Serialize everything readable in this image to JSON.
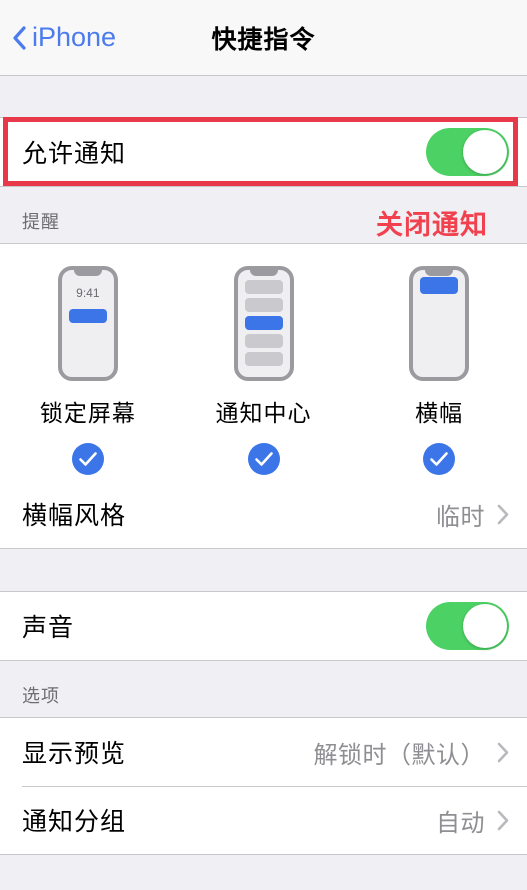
{
  "navbar": {
    "back_label": "iPhone",
    "back_icon": "chevron-left-icon",
    "title": "快捷指令"
  },
  "allow_notifications": {
    "title": "允许通知",
    "toggle_state": "on",
    "toggle_color": "#4CD264"
  },
  "alerts_section": {
    "header": "提醒",
    "previews": [
      {
        "label": "锁定屏幕",
        "time": "9:41",
        "checked": true,
        "type": "lock-screen"
      },
      {
        "label": "通知中心",
        "checked": true,
        "type": "notification-center"
      },
      {
        "label": "横幅",
        "checked": true,
        "type": "banner"
      }
    ],
    "banner_style": {
      "title": "横幅风格",
      "value": "临时",
      "chevron": "chevron-right-icon"
    }
  },
  "sounds": {
    "title": "声音",
    "toggle_state": "on",
    "toggle_color": "#4CD264"
  },
  "options_section": {
    "header": "选项",
    "rows": [
      {
        "title": "显示预览",
        "value": "解锁时（默认）",
        "chevron": "chevron-right-icon"
      },
      {
        "title": "通知分组",
        "value": "自动",
        "chevron": "chevron-right-icon"
      }
    ]
  },
  "annotations": {
    "box_color": "#E8394A",
    "text": "关闭通知",
    "text_color": "#F1404E"
  },
  "theme": {
    "accent_blue": "#4B7BEC",
    "check_blue": "#3B75E8",
    "group_background": "#FFFFFF",
    "page_background": "#EFEFF4",
    "separator": "#C8C7CC",
    "secondary_text": "#8E8E93"
  }
}
